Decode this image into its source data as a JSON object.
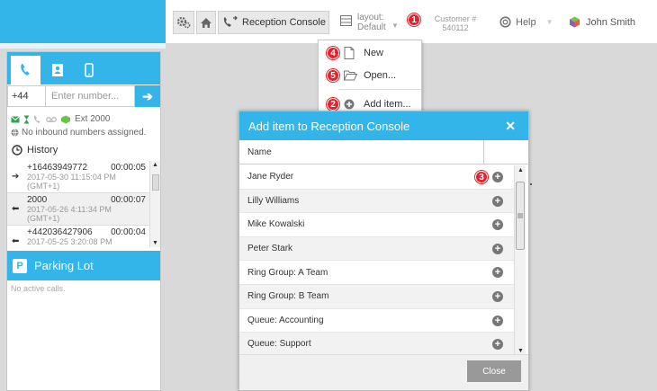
{
  "topbar": {
    "reception_console_label": "Reception Console",
    "layout_label": "layout:",
    "layout_value": "Default",
    "customer_label": "Customer #",
    "customer_number": "540112",
    "help_label": "Help",
    "user_name": "John Smith"
  },
  "badges": [
    "1",
    "2",
    "3",
    "4",
    "5"
  ],
  "dialer": {
    "country_code": "+44",
    "number_placeholder": "Enter number...",
    "extension": "Ext 2000",
    "inbound_status": "No inbound numbers assigned."
  },
  "history": {
    "title": "History",
    "items": [
      {
        "number": "+16463949772",
        "duration": "00:00:05",
        "date": "2017-05-30 11:15:04 PM",
        "tz": "(GMT+1)"
      },
      {
        "number": "2000",
        "duration": "00:00:07",
        "date": "2017-05-26 4:11:34 PM",
        "tz": "(GMT+1)"
      },
      {
        "number": "+442036427906",
        "duration": "00:00:04",
        "date": "2017-05-25 3:20:08 PM",
        "tz": ""
      }
    ]
  },
  "parking": {
    "title": "Parking Lot",
    "empty_text": "No active calls."
  },
  "menu": {
    "new_label": "New",
    "open_label": "Open...",
    "add_item_label": "Add item..."
  },
  "modal": {
    "title": "Add item to Reception Console",
    "column_name": "Name",
    "items": [
      "Jane Ryder",
      "Lilly Williams",
      "Mike Kowalski",
      "Peter Stark",
      "Ring Group: A Team",
      "Ring Group: B Team",
      "Queue: Accounting",
      "Queue: Support"
    ],
    "close_label": "Close"
  },
  "colors": {
    "accent": "#33b5ea",
    "badge_red": "#e8202a"
  }
}
